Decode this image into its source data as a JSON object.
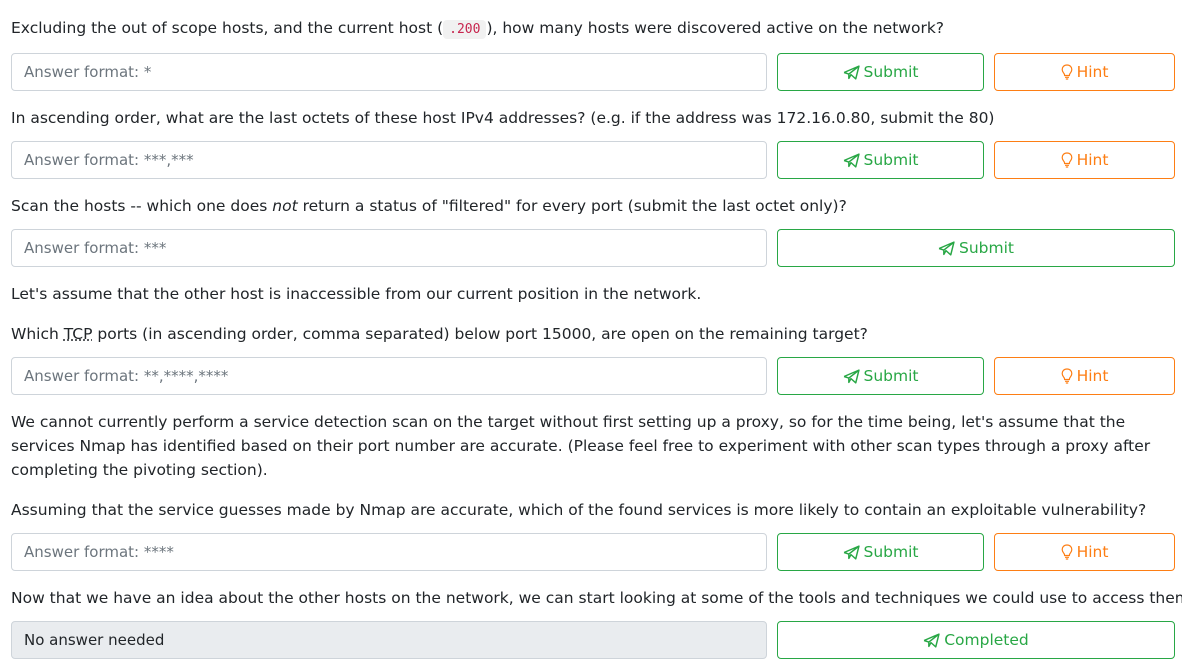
{
  "questions": [
    {
      "text_before": "Excluding the out of scope hosts, and the current host (",
      "code": ".200",
      "text_after": "), how many hosts were discovered active on the network?",
      "placeholder": "Answer format: *",
      "submit_label": "Submit",
      "hint_label": "Hint"
    },
    {
      "text": "In ascending order, what are the last octets of these host IPv4 addresses? (e.g. if the address was 172.16.0.80, submit the 80)",
      "placeholder": "Answer format: ***,***",
      "submit_label": "Submit",
      "hint_label": "Hint"
    },
    {
      "text_before": "Scan the hosts -- which one does ",
      "emphasis": "not",
      "text_after": " return a status of \"filtered\" for every port (submit the last octet only)?",
      "placeholder": "Answer format: ***",
      "submit_label": "Submit"
    },
    {
      "intro": "Let's assume that the other host is inaccessible from our current position in the network.",
      "text_before": "Which ",
      "abbr": "TCP",
      "text_after": " ports (in ascending order, comma separated) below port 15000, are open on the remaining target?",
      "placeholder": "Answer format: **,****,****",
      "submit_label": "Submit",
      "hint_label": "Hint"
    },
    {
      "intro": "We cannot currently perform a service detection scan on the target without first setting up a proxy, so for the time being, let's assume that the services Nmap has identified based on their port number are accurate. (Please feel free to experiment with other scan types through a proxy after completing the pivoting section).",
      "text": "Assuming that the service guesses made by Nmap are accurate, which of the found services is more likely to contain an exploitable vulnerability?",
      "placeholder": "Answer format: ****",
      "submit_label": "Submit",
      "hint_label": "Hint"
    },
    {
      "text": "Now that we have an idea about the other hosts on the network, we can start looking at some of the tools and techniques we could use to access them!",
      "value": "No answer needed",
      "completed_label": "Completed"
    }
  ],
  "colors": {
    "success": "#28a745",
    "warning": "#fd7e14",
    "code": "#c7254e",
    "disabled_bg": "#e9ecef"
  },
  "icons": {
    "submit": "paper-plane-icon",
    "hint": "lightbulb-icon"
  }
}
